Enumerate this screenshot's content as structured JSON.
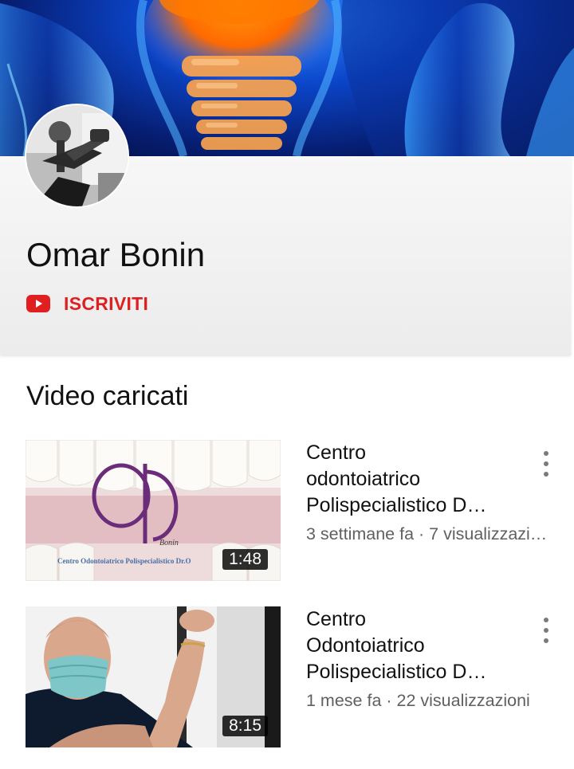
{
  "channel": {
    "name": "Omar Bonin",
    "subscribe_label": "ISCRIVITI"
  },
  "section": {
    "title": "Video caricati"
  },
  "videos": [
    {
      "title_lines": [
        "Centro",
        "odontoiatrico",
        "Polispecialistico D…"
      ],
      "meta": "3 settimane fa · 7 visualizzazi…",
      "duration": "1:48",
      "thumb_caption": "Centro Odontoiatrico Polispecialistico Dr.O",
      "thumb_logo_text": "Bonin"
    },
    {
      "title_lines": [
        "Centro",
        "Odontoiatrico",
        "Polispecialistico D…"
      ],
      "meta": "1 mese fa · 22 visualizzazioni",
      "duration": "8:15"
    }
  ],
  "colors": {
    "accent_red": "#e02020",
    "banner_blue": "#0b45c9",
    "meta_gray": "#606060"
  },
  "icons": {
    "subscribe": "youtube-logo-icon",
    "menu": "more-vertical-icon"
  }
}
